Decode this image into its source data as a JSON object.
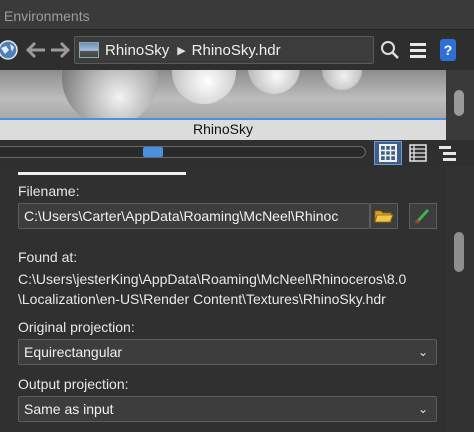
{
  "window": {
    "title": "Environments"
  },
  "nav": {
    "breadcrumb": [
      "RhinoSky",
      "RhinoSky.hdr"
    ],
    "icons": [
      "globe-icon",
      "back-arrow-icon",
      "forward-arrow-icon",
      "search-icon",
      "menu-icon",
      "help-icon"
    ]
  },
  "preview": {
    "label": "RhinoSky"
  },
  "slider": {
    "level": 0.4
  },
  "content": {
    "filename_label": "Filename:",
    "filename_value": "C:\\Users\\Carter\\AppData\\Roaming\\McNeel\\Rhinoc",
    "found_at_label": "Found at:",
    "found_at_line1": "C:\\Users\\jesterKing\\AppData\\Roaming\\McNeel\\Rhinoceros\\8.0",
    "found_at_line2": "\\Localization\\en-US\\Render Content\\Textures\\RhinoSky.hdr",
    "original_projection_label": "Original projection:",
    "original_projection_value": "Equirectangular",
    "output_projection_label": "Output projection:",
    "output_projection_value": "Same as input"
  },
  "colors": {
    "accent": "#4a8fe0",
    "background": "#303030",
    "help": "#2f6fd6"
  }
}
